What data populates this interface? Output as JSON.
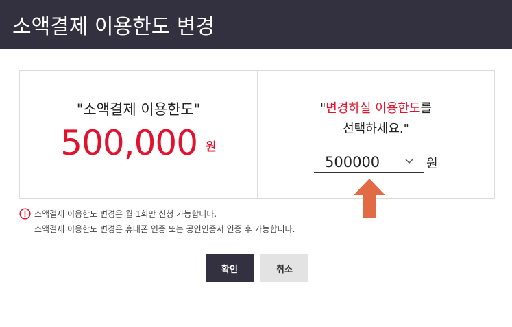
{
  "header": {
    "title": "소액결제 이용한도 변경"
  },
  "current": {
    "label": "\"소액결제 이용한도\"",
    "amount": "500,000",
    "unit": "원"
  },
  "change": {
    "prompt_quote_open": "\"",
    "prompt_highlight": "변경하실 이용한도",
    "prompt_suffix": "를",
    "prompt_line2": "선택하세요.\"",
    "selected_value": "500000",
    "unit": "원"
  },
  "notices": [
    "소액결제 이용한도 변경은 월 1회만 신청 가능합니다.",
    "소액결제 이용한도 변경은 휴대폰 인증 또는 공인인증서 인증 후 가능합니다."
  ],
  "buttons": {
    "confirm": "확인",
    "cancel": "취소"
  },
  "colors": {
    "accent": "#e0122d",
    "header_bg": "#33313f",
    "arrow": "#e06b45"
  },
  "icons": {
    "notice": "alert-circle-icon",
    "select": "chevron-down-icon",
    "pointer": "arrow-up-icon"
  }
}
